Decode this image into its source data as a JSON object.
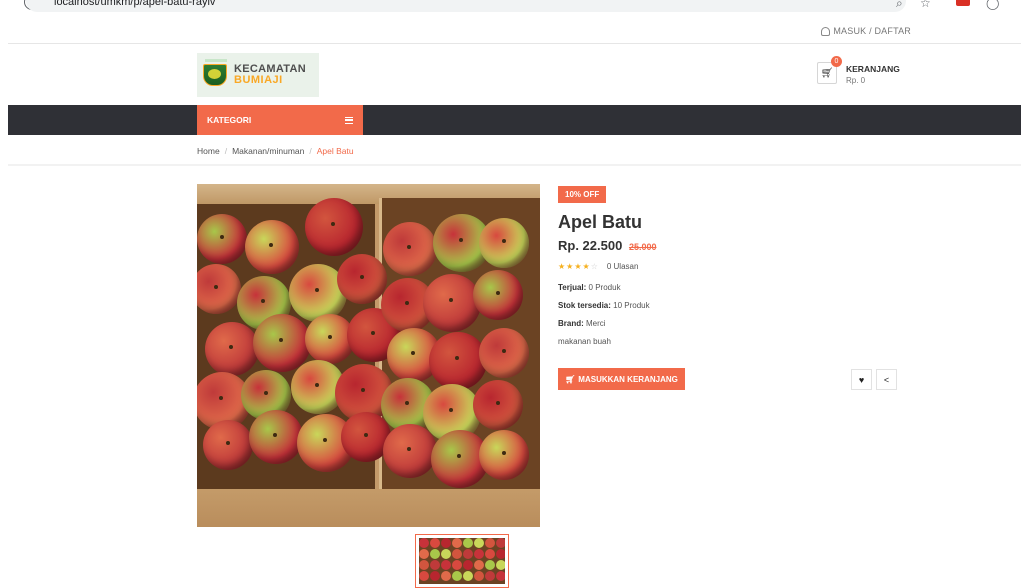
{
  "browser": {
    "url": "localhost/umkm/p/apel-batu-rayiv"
  },
  "topbar": {
    "login_label": "MASUK / DAFTAR"
  },
  "header": {
    "logo_line1": "KECAMATAN",
    "logo_line2": "BUMIAJI",
    "cart_title": "KERANJANG",
    "cart_total": "Rp. 0",
    "cart_count": "0"
  },
  "nav": {
    "category_label": "KATEGORI"
  },
  "breadcrumb": {
    "home": "Home",
    "category": "Makanan/minuman",
    "current": "Apel Batu",
    "separator": "/"
  },
  "product": {
    "discount_badge": "10% OFF",
    "name": "Apel Batu",
    "price": "Rp. 22.500",
    "old_price": "25.000",
    "rating": 4,
    "rating_max": 5,
    "reviews": "0 Ulasan",
    "sold_label": "Terjual:",
    "sold_value": "0 Produk",
    "stock_label": "Stok tersedia:",
    "stock_value": "10 Produk",
    "brand_label": "Brand:",
    "brand_value": "Merci",
    "description": "makanan buah",
    "add_to_cart": "MASUKKAN KERANJANG"
  },
  "colors": {
    "accent": "#f26a4a",
    "navbar": "#2f3036",
    "star": "#f6b01e"
  }
}
